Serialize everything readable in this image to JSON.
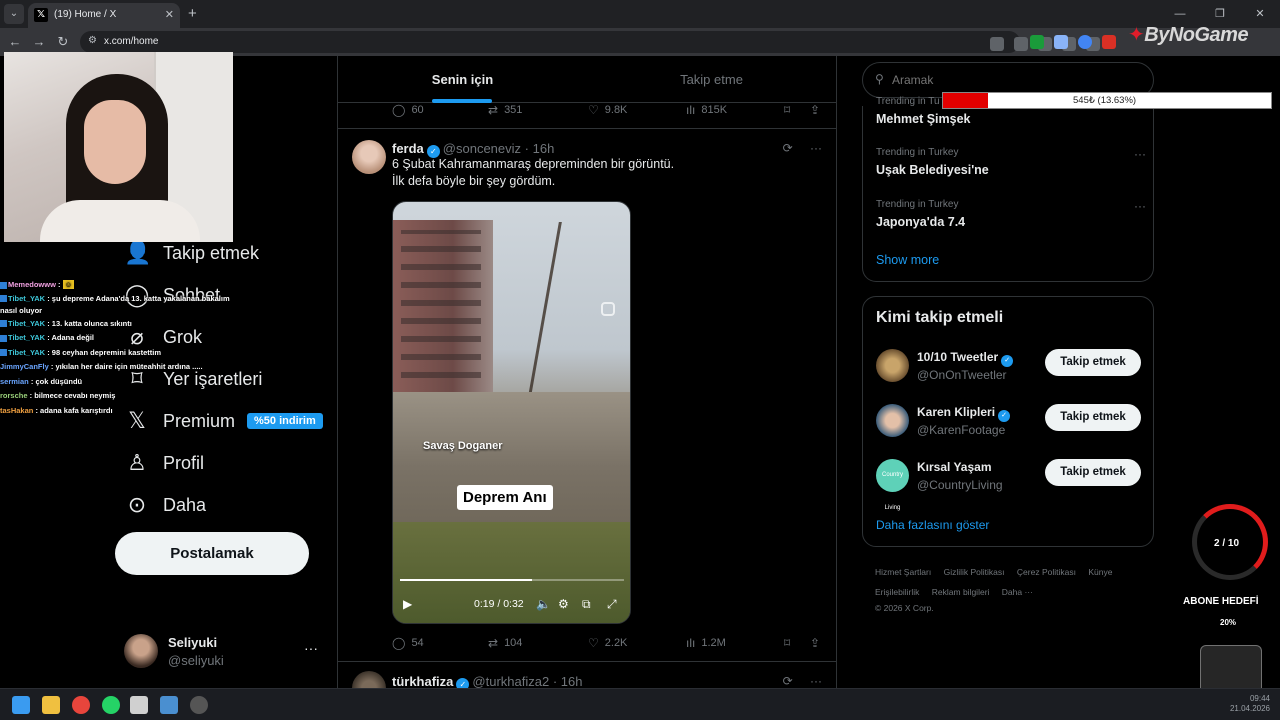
{
  "browser": {
    "tab_title": "(19) Home / X",
    "url": "x.com/home",
    "watermark": "ByNoGame"
  },
  "left_nav": {
    "items": [
      {
        "label": "Takip etmek",
        "icon": "add-user-icon"
      },
      {
        "label": "Sohbet",
        "icon": "chat-icon"
      },
      {
        "label": "Grok",
        "icon": "grok-icon"
      },
      {
        "label": "Yer işaretleri",
        "icon": "bookmark-icon"
      },
      {
        "label": "Premium",
        "icon": "x-logo-icon"
      },
      {
        "label": "Profil",
        "icon": "person-icon"
      },
      {
        "label": "Daha",
        "icon": "more-circle-icon"
      }
    ],
    "premium_badge": "%50 indirim",
    "post_button": "Postalamak",
    "profile": {
      "name": "Seliyuki",
      "handle": "@seliyuki"
    }
  },
  "chat": [
    {
      "user": "Memedowww",
      "message": ""
    },
    {
      "user": "Tibet_YAK",
      "message": "şu depreme Adana'da 13. katta yakalanan bakalım nasıl oluyor"
    },
    {
      "user": "Tibet_YAK",
      "message": "13. katta olunca sıkıntı"
    },
    {
      "user": "Tibet_YAK",
      "message": "Adana değil"
    },
    {
      "user": "Tibet_YAK",
      "message": "98 ceyhan depremini kastettim"
    },
    {
      "user": "JimmyCanFly",
      "message": "yıkılan her daire için müteahhit ardına ....."
    },
    {
      "user": "sermian",
      "message": "çok düşündü"
    },
    {
      "user": "rorsche",
      "message": "bilmece cevabı neymiş"
    },
    {
      "user": "tasHakan",
      "message": "adana kafa karıştırdı"
    }
  ],
  "feed": {
    "tabs": {
      "for_you": "Senin için",
      "following": "Takip etme"
    },
    "prev_tweet_stats": {
      "replies": "60",
      "reposts": "351",
      "likes": "9.8K",
      "views": "815K"
    },
    "tweet": {
      "name": "ferda",
      "handle": "@sonceneviz",
      "time": "16h",
      "text_line1": "6 Şubat Kahramanmaraş depreminden bir görüntü.",
      "text_line2": "İlk defa böyle bir şey gördüm.",
      "video": {
        "watermark": "Savaş Doganer",
        "caption": "Deprem Anı",
        "time_display": "0:19 / 0:32",
        "progress": 0.59
      },
      "stats": {
        "replies": "54",
        "reposts": "104",
        "likes": "2.2K",
        "views": "1.2M"
      }
    },
    "next_tweet": {
      "name": "türkhafiza",
      "handle": "@turkhafiza2",
      "time": "16h"
    }
  },
  "right": {
    "search_placeholder": "Aramak",
    "trends": [
      {
        "category": "Trending in Tu",
        "name": "Mehmet Şimşek"
      },
      {
        "category": "Trending in Turkey",
        "name": "Uşak Belediyesi'ne"
      },
      {
        "category": "Trending in Turkey",
        "name": "Japonya'da 7.4"
      }
    ],
    "show_more": "Show more",
    "who_to_follow": {
      "title": "Kimi takip etmeli",
      "accounts": [
        {
          "name": "10/10 Tweetler",
          "handle": "@OnOnTweetler",
          "verified": true,
          "button": "Takip etmek"
        },
        {
          "name": "Karen Klipleri",
          "handle": "@KarenFootage",
          "verified": true,
          "button": "Takip etmek"
        },
        {
          "name": "Kırsal Yaşam",
          "handle": "@CountryLiving",
          "verified": false,
          "button": "Takip etmek"
        }
      ],
      "more": "Daha fazlasını göster"
    },
    "footer": {
      "links": [
        "Hizmet Şartları",
        "Gizlilik Politikası",
        "Çerez Politikası",
        "Künye",
        "Erişilebilirlik",
        "Reklam bilgileri",
        "Daha ···"
      ],
      "copyright": "© 2026 X Corp."
    }
  },
  "overlays": {
    "donation_text": "545₺ (13.63%)",
    "donation_progress": 0.1363,
    "sub_goal_count": "2 / 10",
    "sub_goal_label": "ABONE HEDEFİ",
    "sub_goal_percent": "20%"
  },
  "taskbar": {
    "time": "09:44",
    "date": "21.04.2026"
  },
  "colors": {
    "accent": "#1d9bf0",
    "background": "#000000",
    "border": "#2f3336",
    "muted_text": "#71767b"
  }
}
